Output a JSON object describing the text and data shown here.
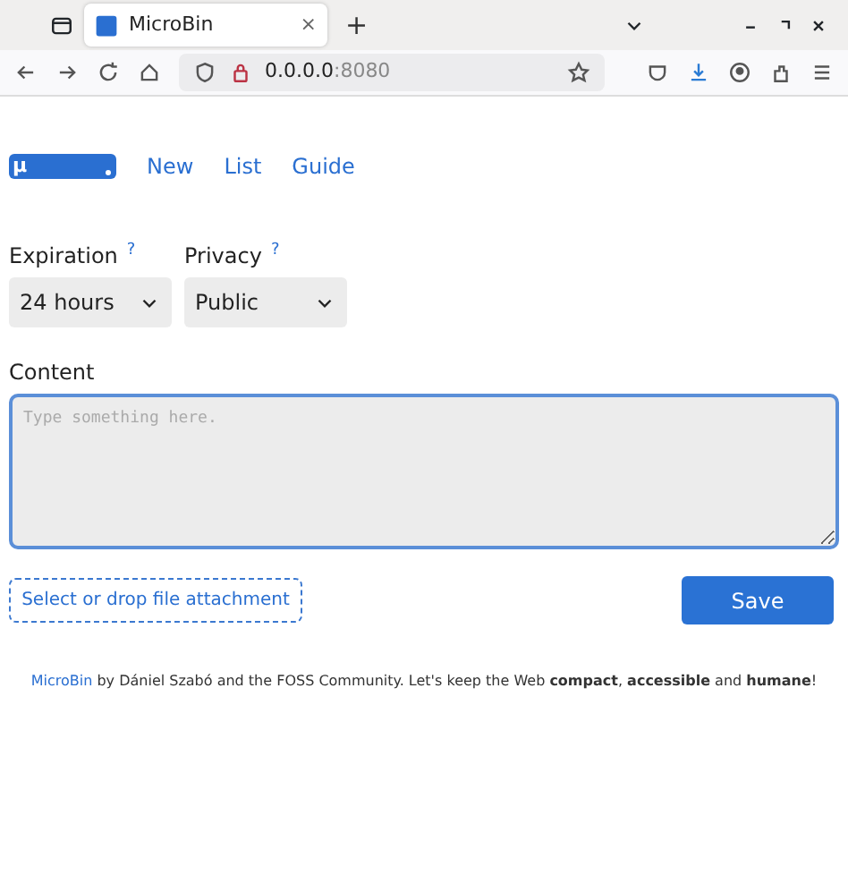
{
  "browser": {
    "tab": {
      "title": "MicroBin",
      "close": "×",
      "selected": true
    },
    "new_tab": "+",
    "url_host": "0.0.0.0",
    "url_port": ":8080"
  },
  "logo": {
    "text": "μ"
  },
  "nav": [
    {
      "label": "New"
    },
    {
      "label": "List"
    },
    {
      "label": "Guide"
    }
  ],
  "fields": [
    {
      "label": "Expiration",
      "help": "?",
      "value": "24 hours"
    },
    {
      "label": "Privacy",
      "help": "?",
      "value": "Public"
    }
  ],
  "content": {
    "label": "Content",
    "placeholder": "Type something here."
  },
  "attach": "Select or drop file attachment",
  "save": "Save",
  "footer": {
    "link": "MicroBin",
    "text": " by Dániel Szabó and the FOSS Community. Let's keep the Web **compact**, **accessible** and **humane**!"
  }
}
